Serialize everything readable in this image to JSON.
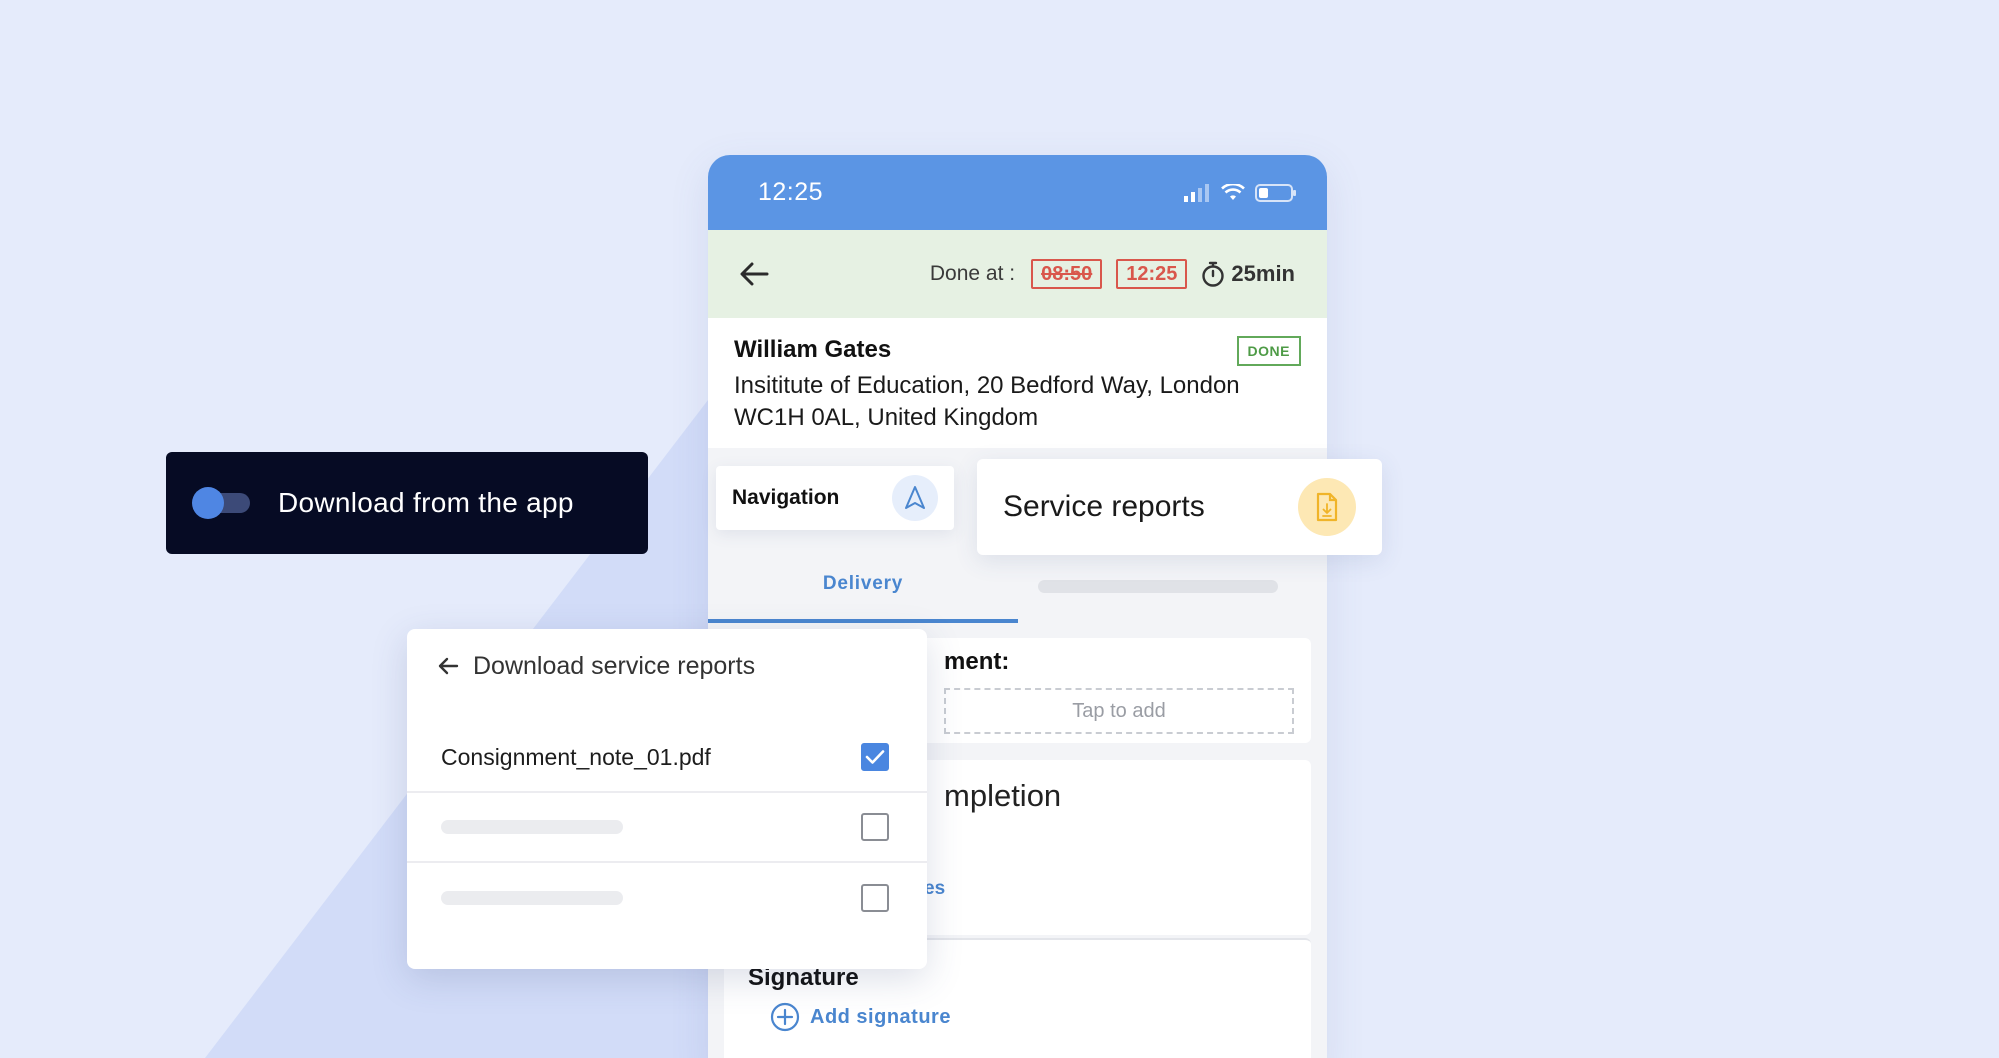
{
  "colors": {
    "page_bg": "#e5ebfb",
    "accent_blue": "#5b95e4",
    "done_green": "#4e9b46",
    "late_red": "#d9574c",
    "dark_panel": "#060b24",
    "service_icon_bg": "#fde8b4"
  },
  "status_bar": {
    "time": "12:25",
    "icons": [
      "signal-icon",
      "wifi-icon",
      "battery-icon"
    ]
  },
  "done_bar": {
    "label": "Done at :",
    "planned_time": "08:50",
    "actual_time": "12:25",
    "duration": "25min"
  },
  "customer": {
    "name": "William Gates",
    "address": "Insititute of Education, 20 Bedford Way, London WC1H 0AL, United Kingdom",
    "status_badge": "DONE"
  },
  "navigation": {
    "label": "Navigation"
  },
  "service_reports": {
    "label": "Service reports"
  },
  "tabs": {
    "active": "Delivery"
  },
  "comment": {
    "title_partial": "ment:",
    "placeholder": "Tap to add"
  },
  "completion": {
    "title_partial": "mpletion",
    "link_partial": "es"
  },
  "signature": {
    "title": "Signature",
    "add_label": "Add signature"
  },
  "toggle": {
    "label": "Download from the app",
    "enabled": false
  },
  "modal": {
    "title": "Download service reports",
    "files": [
      {
        "name": "Consignment_note_01.pdf",
        "checked": true
      },
      {
        "name": "",
        "checked": false
      },
      {
        "name": "",
        "checked": false
      }
    ]
  }
}
